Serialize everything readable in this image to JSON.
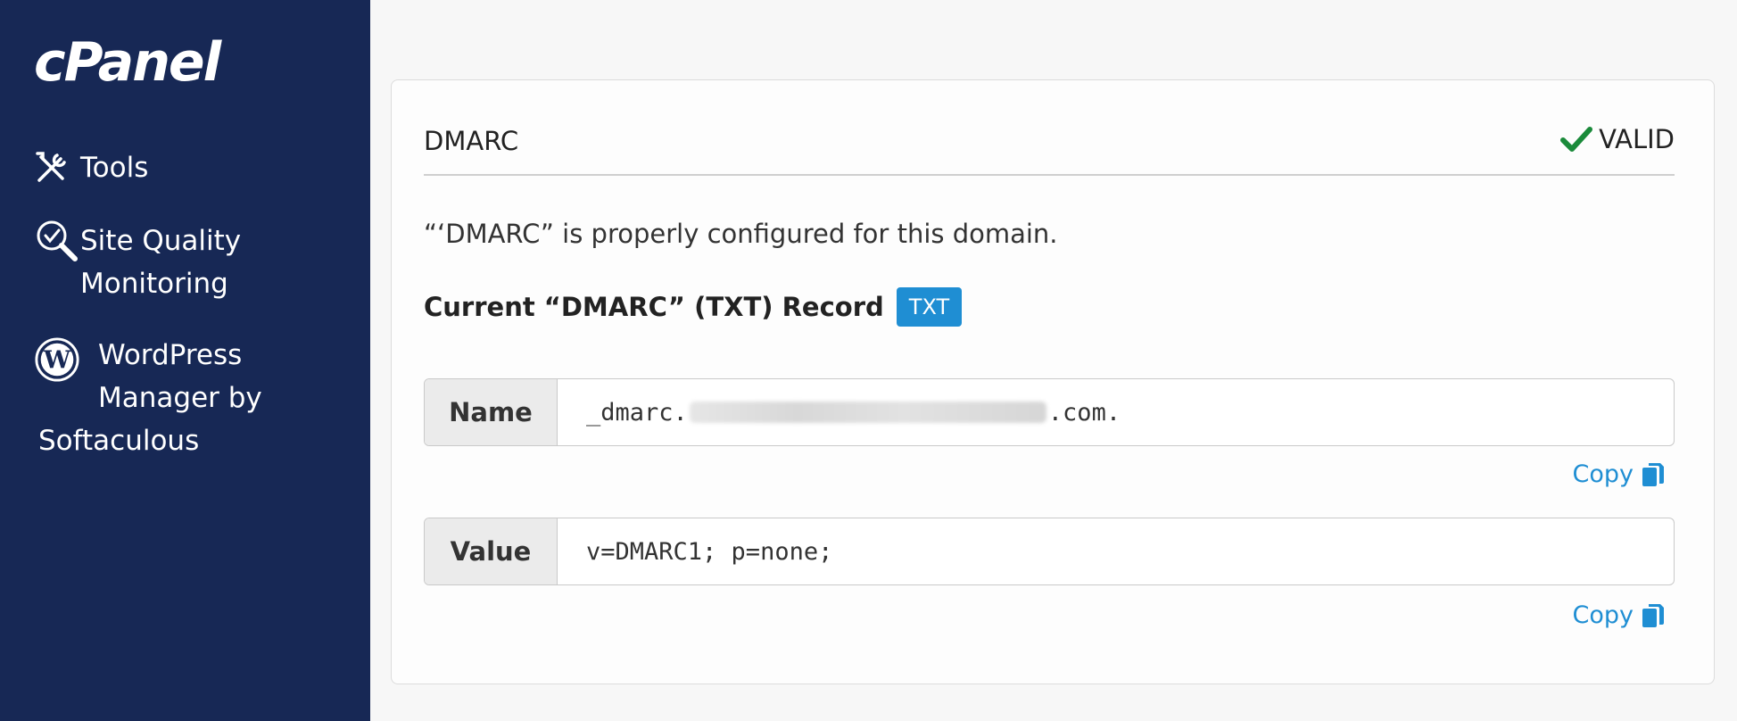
{
  "sidebar": {
    "logo": "cPanel",
    "items": [
      {
        "label": "Tools",
        "icon": "tools-icon"
      },
      {
        "label": "Site Quality\nMonitoring",
        "icon": "magnifier-check-icon"
      },
      {
        "label_line1": "WordPress",
        "label_line2": "Manager by",
        "label_line3": "Softaculous",
        "icon": "wordpress-icon"
      }
    ],
    "background": "#172855"
  },
  "card": {
    "title": "DMARC",
    "status": {
      "label": "VALID",
      "icon": "checkmark-icon",
      "color": "#1a8a3a"
    },
    "message": "“‘DMARC” is properly configured for this domain.",
    "record_heading": "Current “DMARC” (TXT) Record",
    "record_type_badge": "TXT",
    "fields": [
      {
        "key": "Name",
        "value_prefix": "_dmarc.",
        "value_suffix": ".com.",
        "copy_label": "Copy"
      },
      {
        "key": "Value",
        "value": "v=DMARC1; p=none;",
        "copy_label": "Copy"
      }
    ]
  },
  "colors": {
    "accent": "#1f8ed3",
    "valid": "#1a8a3a"
  }
}
